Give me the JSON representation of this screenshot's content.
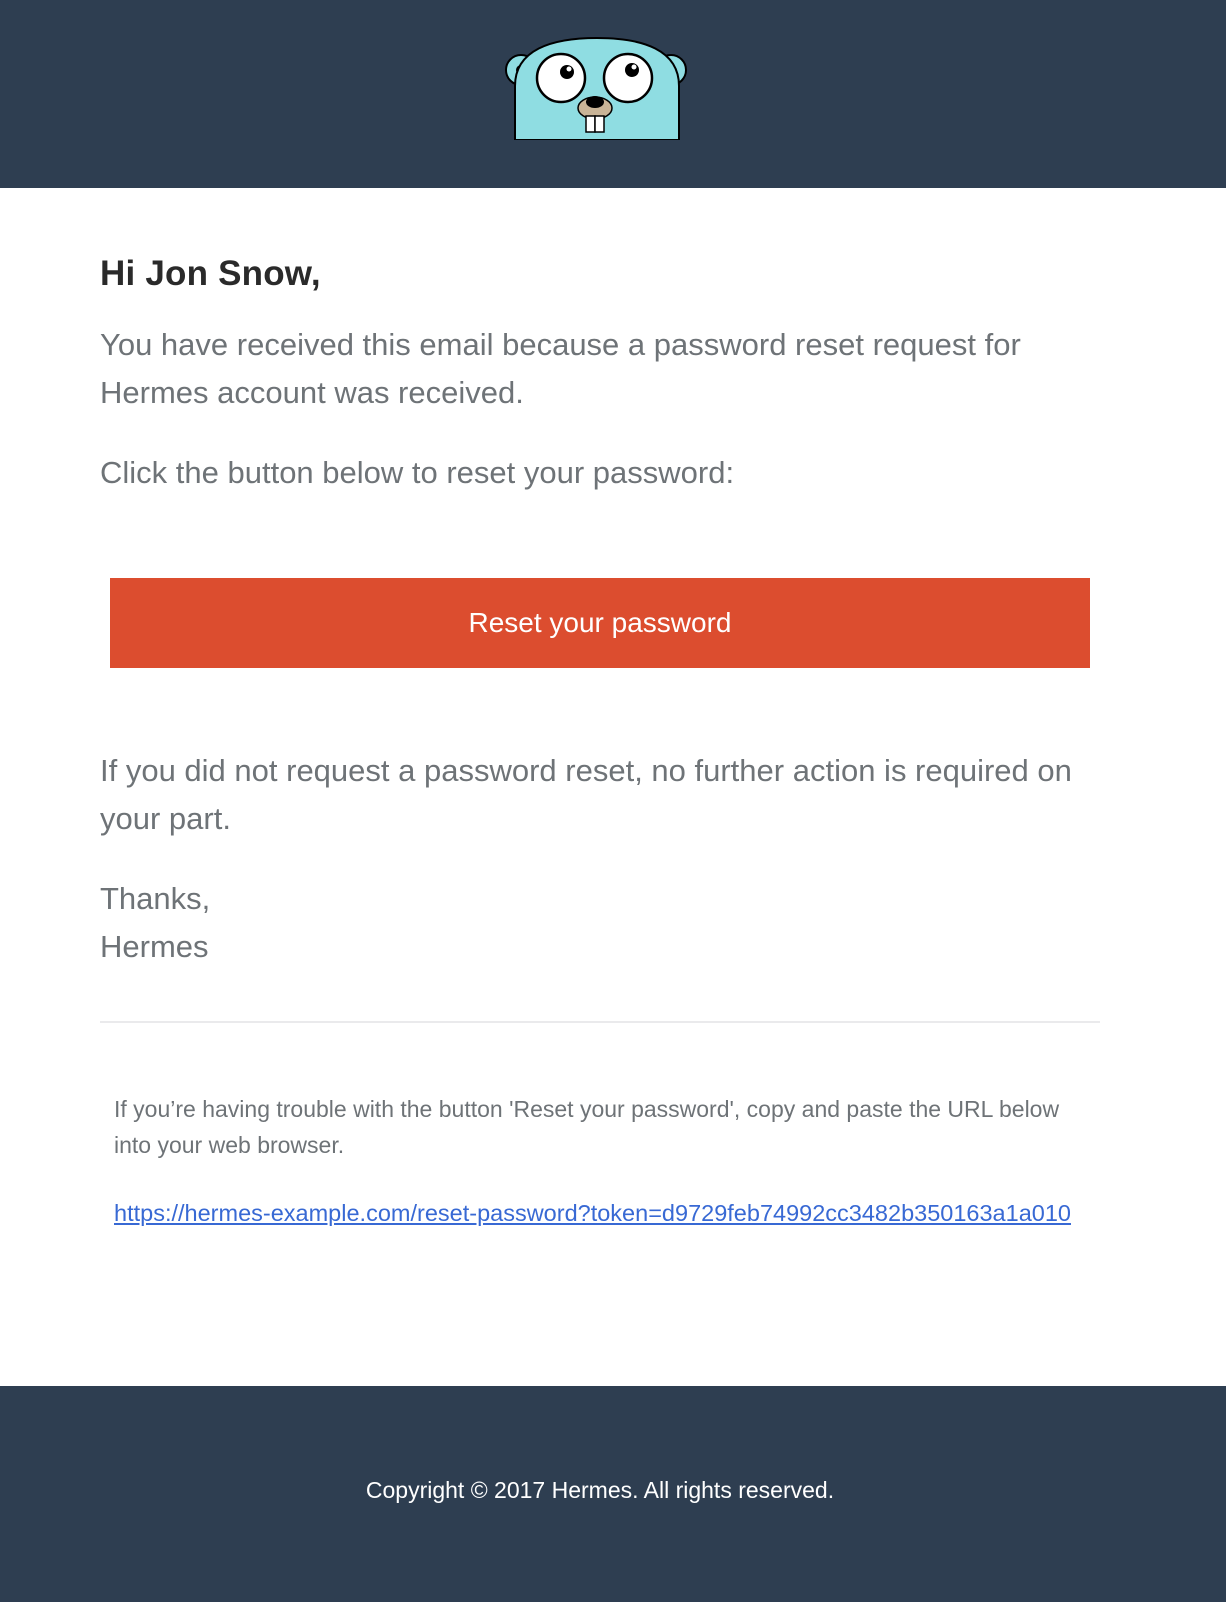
{
  "header": {
    "logo_icon": "gopher-mascot-icon"
  },
  "email": {
    "greeting": "Hi Jon Snow,",
    "intro": "You have received this email because a password reset request for Hermes account was received.",
    "action_instructions": "Click the button below to reset your password:",
    "button_label": "Reset your password",
    "button_color": "#dc4d2f",
    "outro": "If you did not request a password reset, no further action is required on your part.",
    "signoff_line1": "Thanks,",
    "signoff_line2": "Hermes",
    "trouble_note": "If you’re having trouble with the button 'Reset your password', copy and paste the URL below into your web browser.",
    "reset_url": "https://hermes-example.com/reset-password?token=d9729feb74992cc3482b350163a1a010"
  },
  "footer": {
    "copyright": "Copyright © 2017 Hermes. All rights reserved."
  },
  "colors": {
    "header_bg": "#2e3e51",
    "link": "#3869d4",
    "body_text": "#6e7377"
  }
}
